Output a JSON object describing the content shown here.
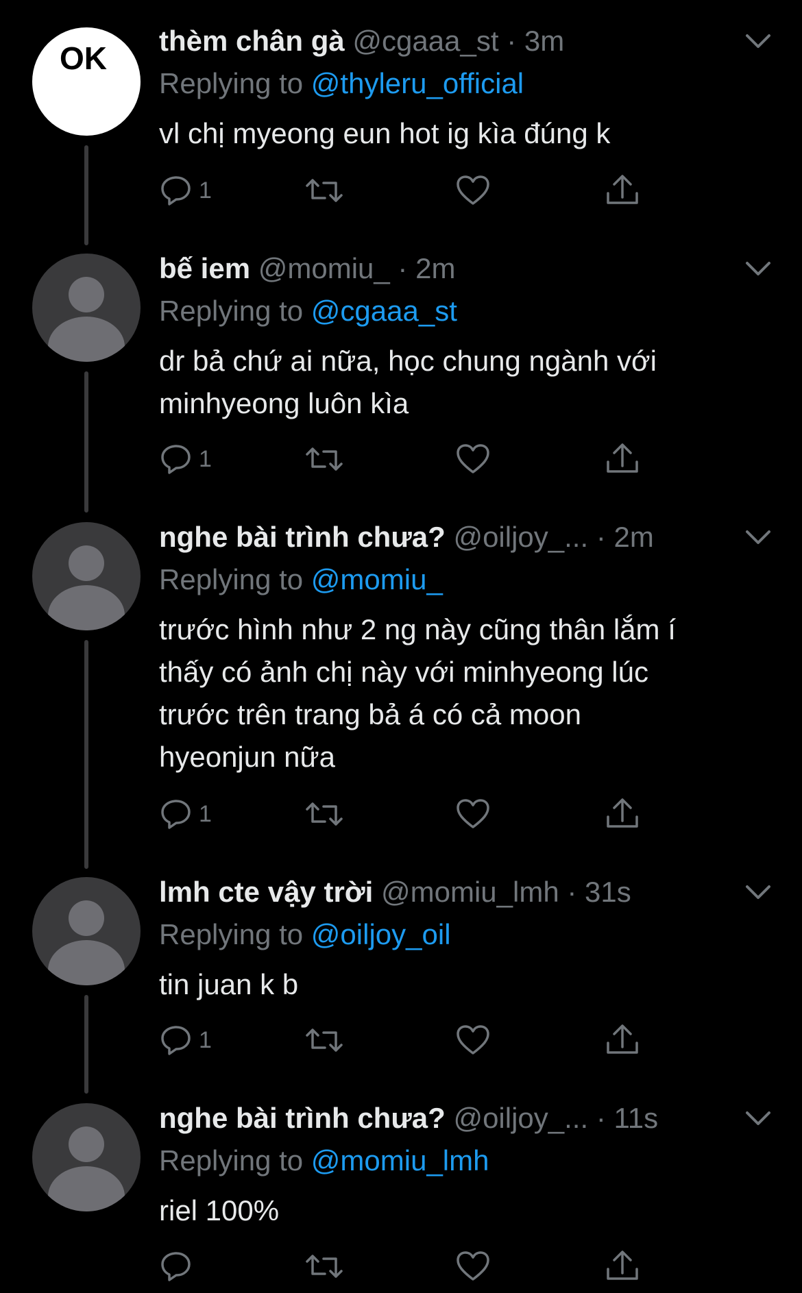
{
  "tweets": [
    {
      "name": "thèm chân gà",
      "handle": "@cgaaa_st",
      "dot": "·",
      "time": "3m",
      "reply_prefix": "Replying to",
      "reply_to": "@thyleru_official",
      "text": "vl chị myeong eun hot ig kìa đúng k",
      "reply_count": "1",
      "avatar_text": "OK"
    },
    {
      "name": "bế iem",
      "handle": "@momiu_",
      "dot": "·",
      "time": "2m",
      "reply_prefix": "Replying to",
      "reply_to": "@cgaaa_st",
      "text_lines": [
        "dr bả chứ ai nữa, học chung ngành với",
        "minhyeong luôn kìa"
      ],
      "reply_count": "1"
    },
    {
      "name": "nghe bài trình chưa?",
      "handle": "@oiljoy_...",
      "dot": "·",
      "time": "2m",
      "reply_prefix": "Replying to",
      "reply_to": "@momiu_",
      "text_lines": [
        "trước hình như 2 ng này cũng thân lắm í",
        "thấy có ảnh chị này với minhyeong lúc",
        "trước trên trang bả á có cả moon",
        "hyeonjun nữa"
      ],
      "reply_count": "1"
    },
    {
      "name": "lmh cte vậy trời",
      "handle": "@momiu_lmh",
      "dot": "·",
      "time": "31s",
      "reply_prefix": "Replying to",
      "reply_to": "@oiljoy_oil",
      "text": "tin juan k b",
      "reply_count": "1"
    },
    {
      "name": "nghe bài trình chưa?",
      "handle": "@oiljoy_...",
      "dot": "·",
      "time": "11s",
      "reply_prefix": "Replying to",
      "reply_to": "@momiu_lmh",
      "text": "riel 100%",
      "reply_count": ""
    }
  ],
  "icons": {
    "reply": "speech-bubble-icon",
    "retweet": "retweet-icon",
    "like": "heart-icon",
    "share": "share-icon",
    "more": "chevron-down-icon"
  },
  "colors": {
    "background": "#000000",
    "link": "#1d9bf0",
    "muted": "#71767b",
    "text": "#e7e9ea",
    "avatar_default": "#3a3a3c"
  }
}
